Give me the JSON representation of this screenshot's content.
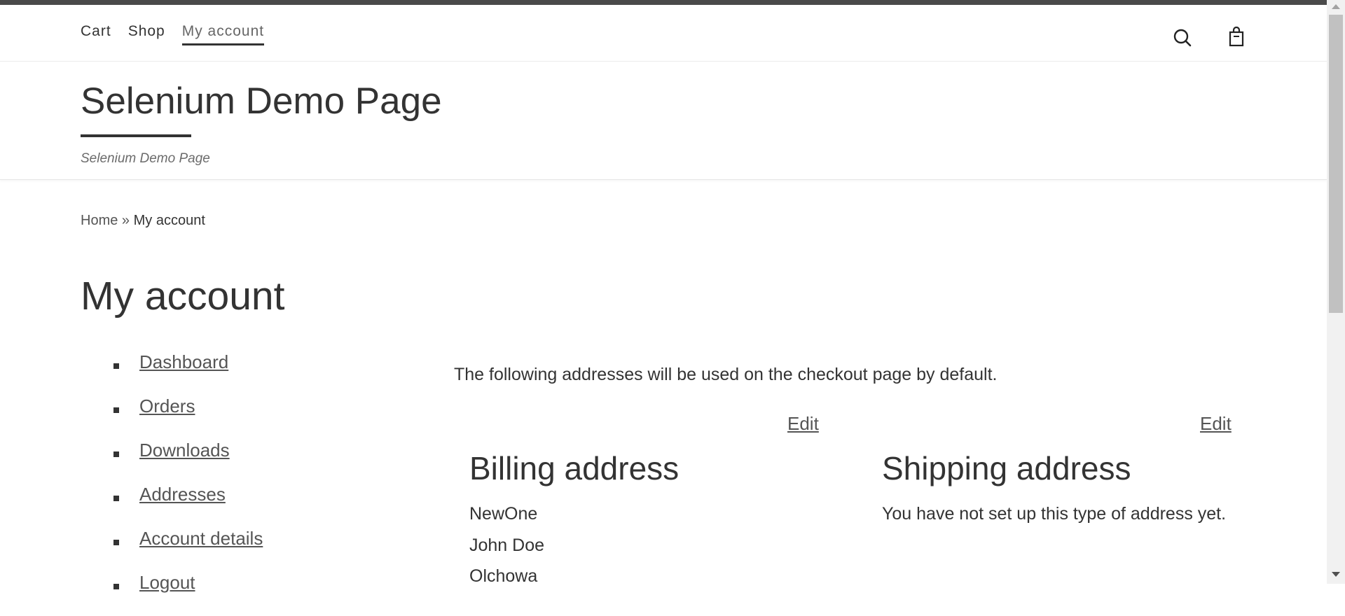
{
  "nav": {
    "links": [
      {
        "label": "Cart"
      },
      {
        "label": "Shop"
      },
      {
        "label": "My account"
      }
    ],
    "search_icon": "search-icon",
    "cart_icon": "shopping-bag-icon"
  },
  "header": {
    "site_title": "Selenium Demo Page",
    "tagline": "Selenium Demo Page"
  },
  "breadcrumb": {
    "home": "Home",
    "separator": "»",
    "current": "My account"
  },
  "page_title": "My account",
  "account_nav": {
    "items": [
      {
        "label": "Dashboard"
      },
      {
        "label": "Orders"
      },
      {
        "label": "Downloads"
      },
      {
        "label": "Addresses"
      },
      {
        "label": "Account details"
      },
      {
        "label": "Logout"
      }
    ]
  },
  "addresses": {
    "intro": "The following addresses will be used on the checkout page by default.",
    "billing": {
      "edit_label": "Edit",
      "title": "Billing address",
      "lines": [
        "NewOne",
        "John Doe",
        "Olchowa"
      ]
    },
    "shipping": {
      "edit_label": "Edit",
      "title": "Shipping address",
      "message": "You have not set up this type of address yet."
    }
  },
  "colors": {
    "text": "#333333",
    "link": "#555555",
    "top_bar": "#4a4a4a"
  }
}
